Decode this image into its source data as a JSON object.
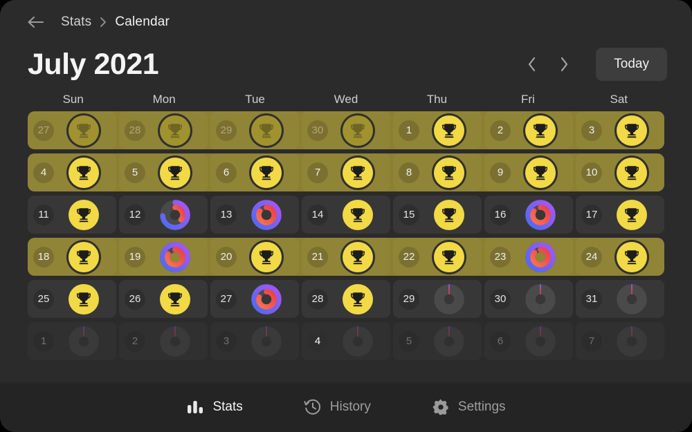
{
  "window": {
    "background": "#2b2b2b"
  },
  "breadcrumb": {
    "back_icon": "arrow-left-icon",
    "parent": "Stats",
    "separator_icon": "chevron-right-icon",
    "current": "Calendar"
  },
  "header": {
    "title": "July 2021",
    "prev_icon": "chevron-left-icon",
    "next_icon": "chevron-right-icon",
    "today_label": "Today"
  },
  "weekdays": [
    "Sun",
    "Mon",
    "Tue",
    "Wed",
    "Thu",
    "Fri",
    "Sat"
  ],
  "colors": {
    "accent_trophy": "#f2d946",
    "row_highlight": "#8c8030",
    "ring_outer_start": "#4a6cf0",
    "ring_outer_end": "#a855f7",
    "ring_inner_start": "#f97350",
    "ring_inner_end": "#e8404a",
    "today_badge": "#2b62b0",
    "cell_background": "#373737",
    "nav_background": "#242424"
  },
  "weeks": [
    {
      "highlight": true,
      "days": [
        {
          "num": "27",
          "month": "prev",
          "badge": "trophy",
          "faded": true
        },
        {
          "num": "28",
          "month": "prev",
          "badge": "trophy",
          "faded": true
        },
        {
          "num": "29",
          "month": "prev",
          "badge": "trophy",
          "faded": true
        },
        {
          "num": "30",
          "month": "prev",
          "badge": "trophy",
          "faded": true
        },
        {
          "num": "1",
          "month": "current",
          "badge": "trophy",
          "faded": false
        },
        {
          "num": "2",
          "month": "current",
          "badge": "trophy",
          "faded": false
        },
        {
          "num": "3",
          "month": "current",
          "badge": "trophy",
          "faded": false
        }
      ]
    },
    {
      "highlight": true,
      "days": [
        {
          "num": "4",
          "month": "current",
          "badge": "trophy",
          "faded": false
        },
        {
          "num": "5",
          "month": "current",
          "badge": "trophy",
          "faded": false
        },
        {
          "num": "6",
          "month": "current",
          "badge": "trophy",
          "faded": false
        },
        {
          "num": "7",
          "month": "current",
          "badge": "trophy",
          "faded": false
        },
        {
          "num": "8",
          "month": "current",
          "badge": "trophy",
          "faded": false
        },
        {
          "num": "9",
          "month": "current",
          "badge": "trophy",
          "faded": false
        },
        {
          "num": "10",
          "month": "current",
          "badge": "trophy",
          "faded": false
        }
      ]
    },
    {
      "highlight": false,
      "days": [
        {
          "num": "11",
          "month": "current",
          "badge": "trophy",
          "faded": false
        },
        {
          "num": "12",
          "month": "current",
          "badge": "rings",
          "outer_pct": 74,
          "inner_pct": 36
        },
        {
          "num": "13",
          "month": "current",
          "badge": "rings",
          "outer_pct": 100,
          "inner_pct": 84
        },
        {
          "num": "14",
          "month": "current",
          "badge": "trophy",
          "faded": false
        },
        {
          "num": "15",
          "month": "current",
          "badge": "trophy",
          "faded": false
        },
        {
          "num": "16",
          "month": "current",
          "badge": "rings",
          "outer_pct": 100,
          "inner_pct": 84
        },
        {
          "num": "17",
          "month": "current",
          "badge": "trophy",
          "faded": false
        }
      ]
    },
    {
      "highlight": true,
      "days": [
        {
          "num": "18",
          "month": "current",
          "badge": "trophy",
          "faded": false
        },
        {
          "num": "19",
          "month": "current",
          "badge": "rings",
          "outer_pct": 100,
          "inner_pct": 82
        },
        {
          "num": "20",
          "month": "current",
          "badge": "trophy",
          "faded": false
        },
        {
          "num": "21",
          "month": "current",
          "badge": "trophy",
          "faded": false
        },
        {
          "num": "22",
          "month": "current",
          "badge": "trophy",
          "faded": false
        },
        {
          "num": "23",
          "month": "current",
          "badge": "rings",
          "outer_pct": 100,
          "inner_pct": 86
        },
        {
          "num": "24",
          "month": "current",
          "badge": "trophy",
          "faded": false
        }
      ]
    },
    {
      "highlight": false,
      "days": [
        {
          "num": "25",
          "month": "current",
          "badge": "trophy",
          "faded": false
        },
        {
          "num": "26",
          "month": "current",
          "badge": "trophy",
          "faded": false
        },
        {
          "num": "27",
          "month": "current",
          "badge": "rings",
          "outer_pct": 100,
          "inner_pct": 80
        },
        {
          "num": "28",
          "month": "current",
          "badge": "trophy",
          "faded": false
        },
        {
          "num": "29",
          "month": "current",
          "badge": "rings",
          "outer_pct": 0,
          "inner_pct": 0
        },
        {
          "num": "30",
          "month": "current",
          "badge": "rings",
          "outer_pct": 0,
          "inner_pct": 0
        },
        {
          "num": "31",
          "month": "current",
          "badge": "rings",
          "outer_pct": 0,
          "inner_pct": 0
        }
      ]
    },
    {
      "highlight": false,
      "days": [
        {
          "num": "1",
          "month": "next",
          "badge": "rings",
          "outer_pct": 0,
          "inner_pct": 0,
          "dim": true
        },
        {
          "num": "2",
          "month": "next",
          "badge": "rings",
          "outer_pct": 0,
          "inner_pct": 0,
          "dim": true
        },
        {
          "num": "3",
          "month": "next",
          "badge": "rings",
          "outer_pct": 0,
          "inner_pct": 0,
          "dim": true
        },
        {
          "num": "4",
          "month": "next",
          "badge": "rings",
          "outer_pct": 0,
          "inner_pct": 0,
          "dim": true,
          "today": true
        },
        {
          "num": "5",
          "month": "next",
          "badge": "rings",
          "outer_pct": 0,
          "inner_pct": 0,
          "dim": true
        },
        {
          "num": "6",
          "month": "next",
          "badge": "rings",
          "outer_pct": 0,
          "inner_pct": 0,
          "dim": true
        },
        {
          "num": "7",
          "month": "next",
          "badge": "rings",
          "outer_pct": 0,
          "inner_pct": 0,
          "dim": true
        }
      ]
    }
  ],
  "bottom_nav": [
    {
      "label": "Stats",
      "icon": "bar-chart-icon",
      "active": true
    },
    {
      "label": "History",
      "icon": "clock-history-icon",
      "active": false
    },
    {
      "label": "Settings",
      "icon": "gear-icon",
      "active": false
    }
  ]
}
